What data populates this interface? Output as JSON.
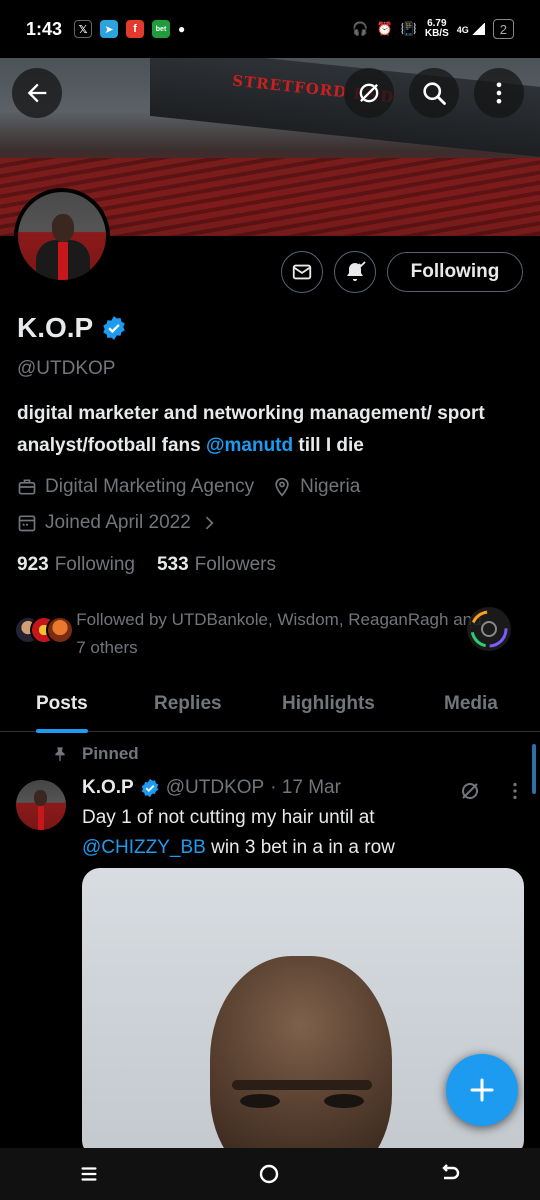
{
  "status_bar": {
    "time": "1:43",
    "net_speed": "6.79",
    "net_unit": "KB/S",
    "signal": "4G",
    "battery": "2"
  },
  "banner": {
    "stand_sign": "STRETFORD END"
  },
  "profile": {
    "name": "K.O.P",
    "handle": "@UTDKOP",
    "bio_part1": "digital marketer and networking management/ sport analyst/football fans ",
    "bio_mention": "@manutd",
    "bio_part2": " till I die",
    "category": "Digital Marketing Agency",
    "location": "Nigeria",
    "joined": "Joined April 2022",
    "following_count": "923",
    "following_label": "Following",
    "followers_count": "533",
    "followers_label": "Followers",
    "follow_button": "Following",
    "followed_by": "Followed by UTDBankole, Wisdom, ReaganRagh and 7 others"
  },
  "tabs": [
    {
      "label": "Posts",
      "active": true
    },
    {
      "label": "Replies",
      "active": false
    },
    {
      "label": "Highlights",
      "active": false
    },
    {
      "label": "Media",
      "active": false
    }
  ],
  "pinned_post": {
    "pinned_label": "Pinned",
    "author": "K.O.P",
    "handle": "@UTDKOP",
    "date": "· 17 Mar",
    "text_part1": "Day 1 of not cutting my hair until at",
    "mention": "@CHIZZY_BB",
    "text_part2": " win 3 bet in a in a row"
  },
  "colors": {
    "accent": "#1d9bf0",
    "background": "#000000",
    "secondary_text": "#71767b",
    "primary_text": "#e7e9ea"
  }
}
